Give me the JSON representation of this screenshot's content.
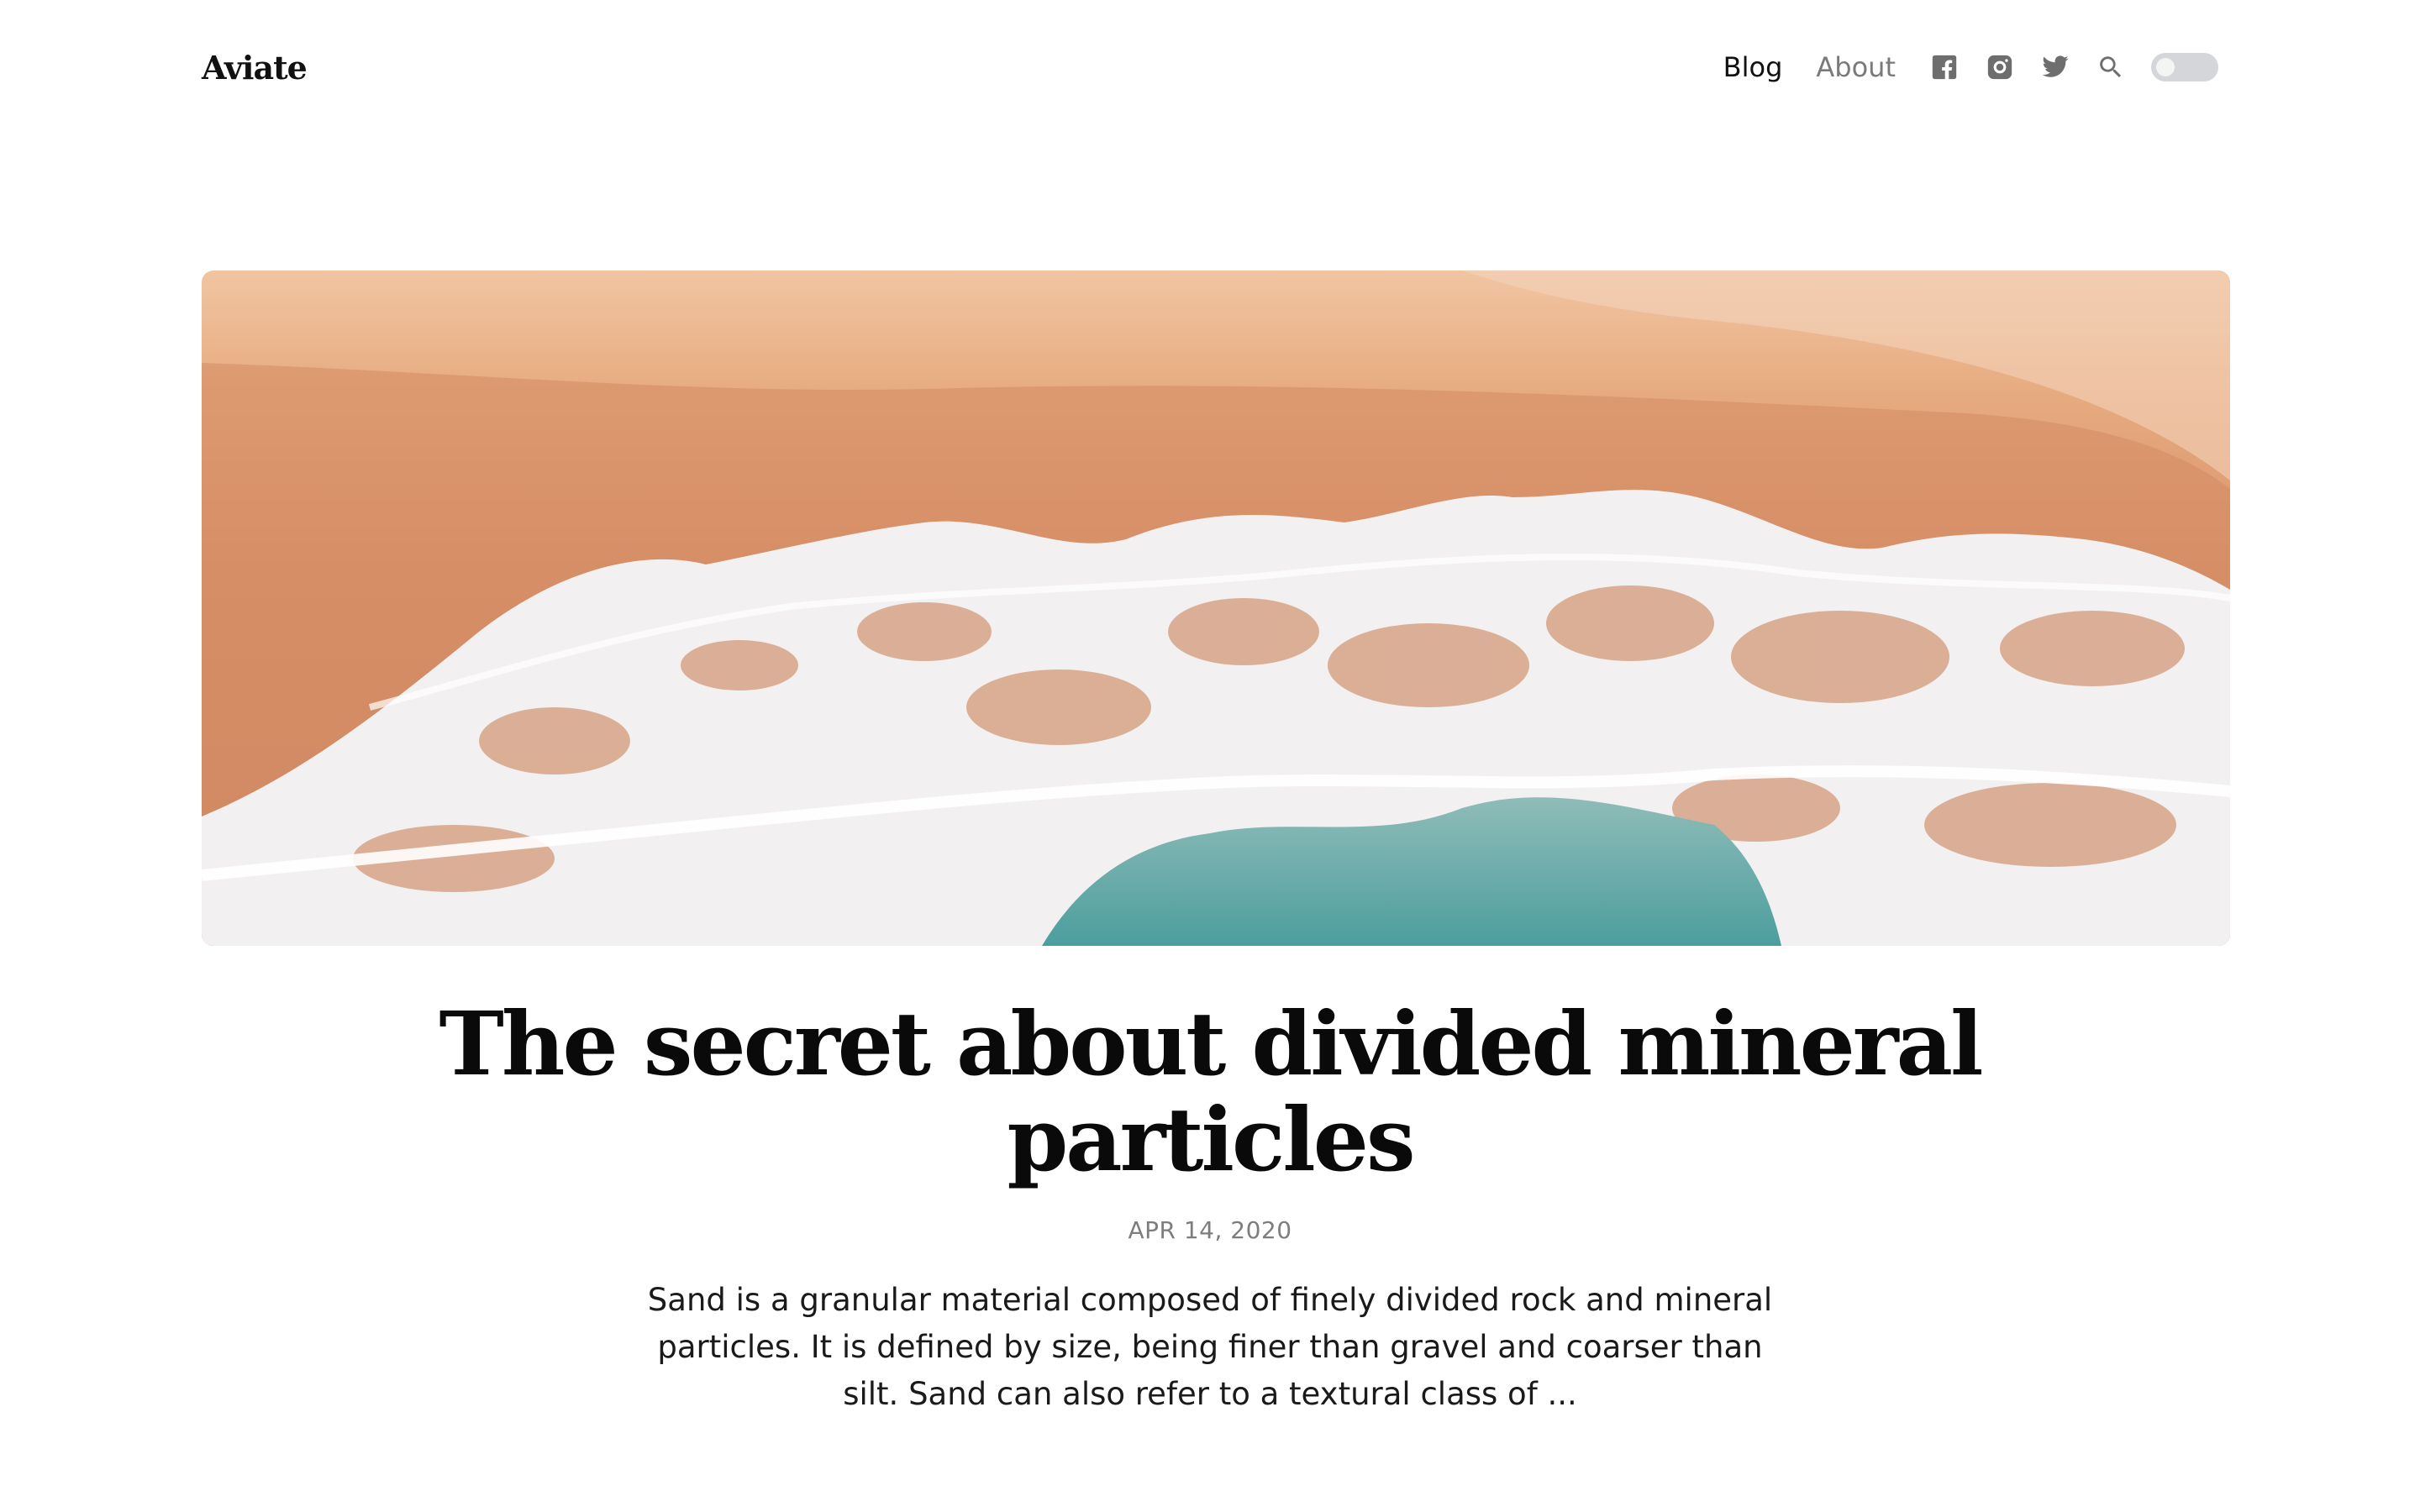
{
  "site": {
    "logo": "Aviate"
  },
  "nav": {
    "blog": "Blog",
    "about": "About",
    "icons": [
      "facebook-icon",
      "instagram-icon",
      "twitter-icon",
      "search-icon",
      "theme-toggle"
    ]
  },
  "post": {
    "title": "The secret about divided mineral particles",
    "date": "APR 14, 2020",
    "excerpt": "Sand is a granular material composed of finely divided rock and mineral particles. It is defined by size, being finer than gravel and coarser than silt. Sand can also refer to a textural class of ..."
  },
  "colors": {
    "text": "#111111",
    "muted": "#7a7a7a",
    "sand": "#d9956a",
    "foam": "#f2eeee",
    "water": "#5ea9a8"
  }
}
